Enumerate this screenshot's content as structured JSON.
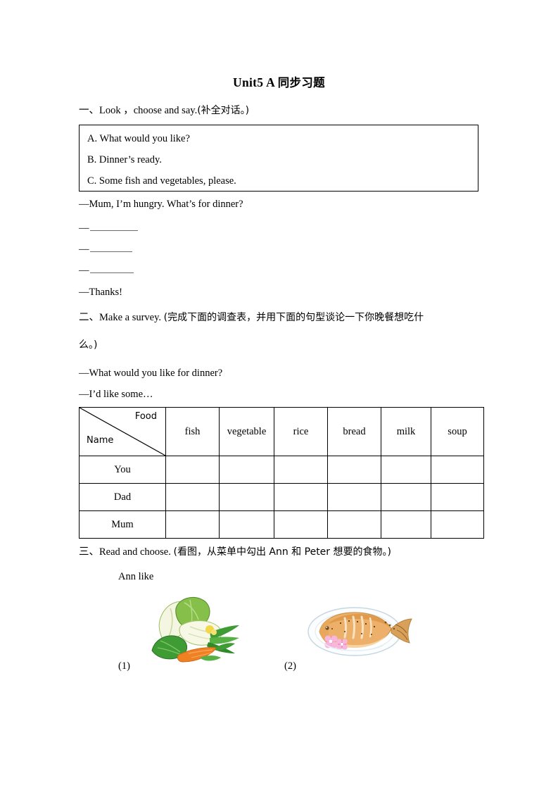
{
  "document": {
    "title_en": "Unit5 A",
    "title_cn": "同步习题"
  },
  "section1": {
    "number": "一、",
    "instruction_en": "Look ，choose and say.",
    "instruction_cn": "(补全对话。)",
    "options": [
      "A. What would you like?",
      "B. Dinner’s ready.",
      "C. Some fish and vegetables, please."
    ],
    "dialogue": {
      "first_line": "—Mum, I’m hungry. What’s for dinner?",
      "blank_lead": "—",
      "last_line": "—Thanks!"
    }
  },
  "section2": {
    "number": "二、",
    "instruction_en": "Make a survey.",
    "instruction_cn_line1": "(完成下面的调查表，并用下面的句型谈论一下你晚餐想吃什",
    "instruction_cn_line2": "么。)",
    "prompt_question": "—What would you like for dinner?",
    "prompt_answer": "—I’d like some…",
    "table": {
      "corner_top_label": "Food",
      "corner_bottom_label": "Name",
      "columns": [
        "fish",
        "vegetable",
        "rice",
        "bread",
        "milk",
        "soup"
      ],
      "rows": [
        "You",
        "Dad",
        "Mum"
      ]
    }
  },
  "section3": {
    "number": "三、",
    "instruction_en": "Read and choose.",
    "instruction_cn": "(看图，从菜单中勾出 Ann 和 Peter 想要的食物。)",
    "subtitle": "Ann like",
    "pictures": [
      {
        "caption": "(1)",
        "alt": "vegetables-picture"
      },
      {
        "caption": "(2)",
        "alt": "cooked-fish-on-plate-picture"
      }
    ]
  }
}
